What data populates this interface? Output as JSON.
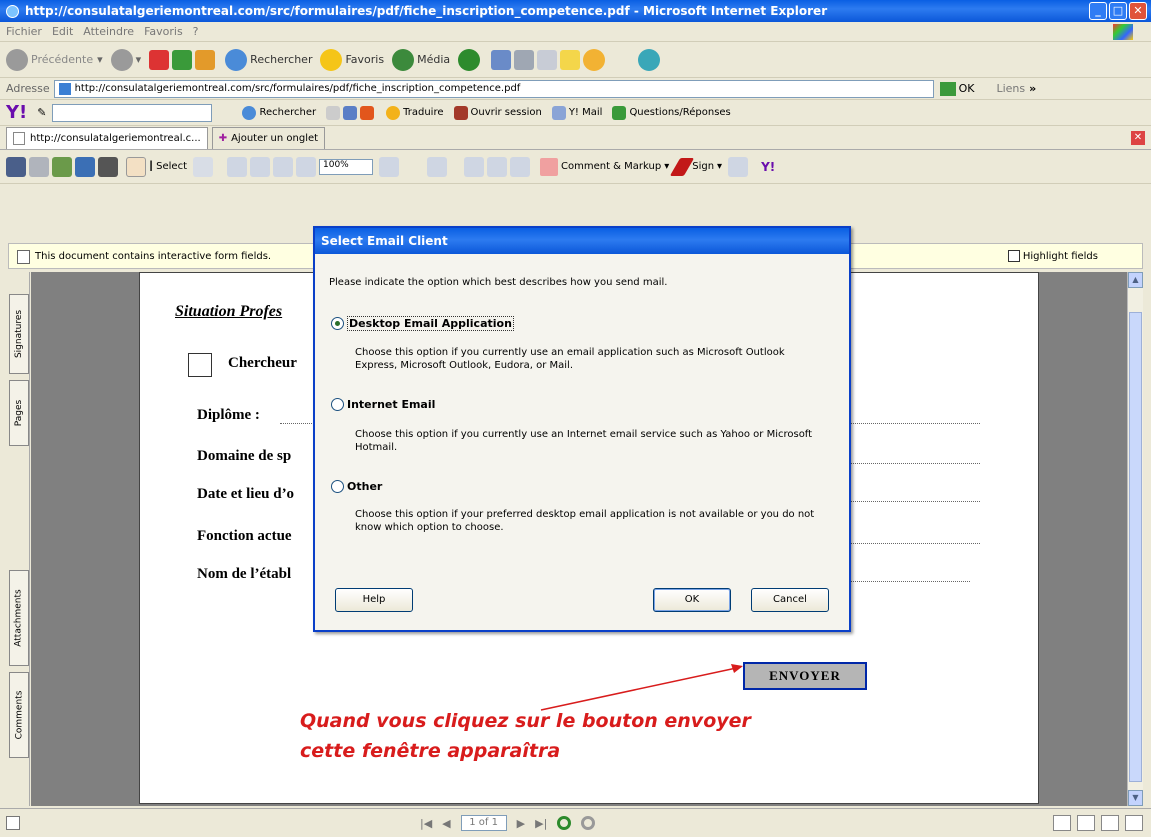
{
  "window": {
    "title": "http://consulatalgeriemontreal.com/src/formulaires/pdf/fiche_inscription_competence.pdf - Microsoft Internet Explorer"
  },
  "menu": [
    "Fichier",
    "Edit",
    "Atteindre",
    "Favoris",
    "?"
  ],
  "toolbar": {
    "back": "Précédente",
    "search": "Rechercher",
    "favorites": "Favoris",
    "media": "Média"
  },
  "address": {
    "label": "Adresse",
    "url": "http://consulatalgeriemontreal.com/src/formulaires/pdf/fiche_inscription_competence.pdf",
    "go": "OK",
    "links": "Liens"
  },
  "yahoo_bar": {
    "search": "Rechercher",
    "translate": "Traduire",
    "signin": "Ouvrir session",
    "mail": "Y! Mail",
    "answers": "Questions/Réponses"
  },
  "tabs": {
    "current": "http://consulatalgeriemontreal.c...",
    "add": "Ajouter un onglet"
  },
  "acrobat_bar": {
    "select": "Select",
    "zoom": "100%",
    "comment": "Comment & Markup",
    "sign": "Sign"
  },
  "infobar": {
    "message": "This document contains interactive form fields.",
    "highlight": "Highlight fields"
  },
  "side_tabs": [
    "Signatures",
    "Pages",
    "Attachments",
    "Comments"
  ],
  "document": {
    "section": "Situation Profes",
    "checkbox_label": "Chercheur",
    "fields": [
      "Diplôme :",
      "Domaine de sp",
      "Date et lieu d’o",
      "Fonction actue",
      "Nom de l’établ"
    ],
    "send_button": "ENVOYER",
    "annotation_line1": "Quand vous cliquez sur le bouton envoyer",
    "annotation_line2": "cette fenêtre apparaîtra"
  },
  "dialog": {
    "title": "Select Email Client",
    "prompt": "Please indicate the option which best describes how you send mail.",
    "options": [
      {
        "label": "Desktop Email Application",
        "desc": "Choose this option if you currently use an email application such as Microsoft Outlook Express, Microsoft Outlook, Eudora, or Mail.",
        "selected": true
      },
      {
        "label": "Internet Email",
        "desc": "Choose this option if you currently use an Internet email service such as Yahoo or Microsoft Hotmail.",
        "selected": false
      },
      {
        "label": "Other",
        "desc": "Choose this option if your preferred desktop email application is not available or you do not know which option to choose.",
        "selected": false
      }
    ],
    "help": "Help",
    "ok": "OK",
    "cancel": "Cancel"
  },
  "status": {
    "page": "1 of 1"
  }
}
